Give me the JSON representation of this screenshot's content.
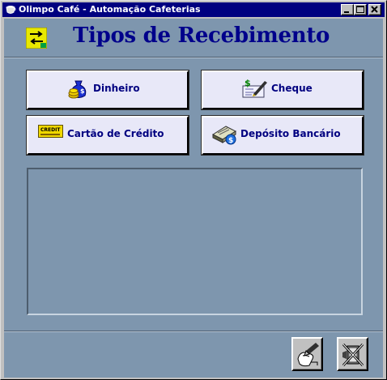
{
  "window": {
    "title": "Olimpo Café - Automação Cafeterias",
    "controls": [
      "minimize",
      "maximize",
      "close"
    ]
  },
  "header": {
    "title": "Tipos de Recebimento",
    "icon": "exchange-icon",
    "title_color": "#00008b"
  },
  "payment_types": [
    {
      "label": "Dinheiro",
      "icon": "money-bag-icon"
    },
    {
      "label": "Cheque",
      "icon": "cheque-icon"
    },
    {
      "label": "Cartão de Crédito",
      "icon": "credit-card-icon",
      "icon_text": "CREDIT"
    },
    {
      "label": "Depósito Bancário",
      "icon": "bank-deposit-icon"
    }
  ],
  "toolbar": {
    "buttons": [
      {
        "icon": "pen-hand-icon"
      },
      {
        "icon": "exit-close-icon"
      }
    ]
  },
  "colors": {
    "background": "#7e96ae",
    "title_bar": "#000080",
    "button_face": "#e8e8f8",
    "button_text": "#000080"
  }
}
